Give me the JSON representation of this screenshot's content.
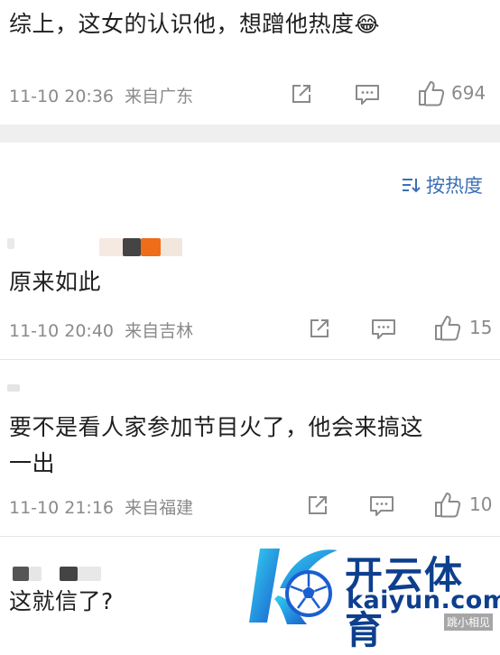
{
  "comments": [
    {
      "text": "综上，这女的认识他，想蹭他热度",
      "emoji": "😂",
      "time": "11-10 20:36",
      "location": "来自广东",
      "likes": "694"
    },
    {
      "text": "原来如此",
      "time": "11-10 20:40",
      "location": "来自吉林",
      "likes": "15"
    },
    {
      "text_line1": "要不是看人家参加节目火了，他会来搞这",
      "text_line2": "一出",
      "time": "11-10 21:16",
      "location": "来自福建",
      "likes": "10"
    },
    {
      "text": "这就信了?"
    }
  ],
  "sort": {
    "label": "按热度"
  },
  "watermark": {
    "brand": "开云体育",
    "domain": "kaiyun.com",
    "corner": "跳小相见"
  },
  "icons": {
    "share": "share-icon",
    "comment": "comment-icon",
    "like": "thumbs-up-icon",
    "sort": "sort-icon"
  },
  "colors": {
    "link_blue": "#3b6fb6",
    "meta_gray": "#8a8a8a",
    "band_gray": "#efefef",
    "brand_blue": "#0e3f8e"
  }
}
